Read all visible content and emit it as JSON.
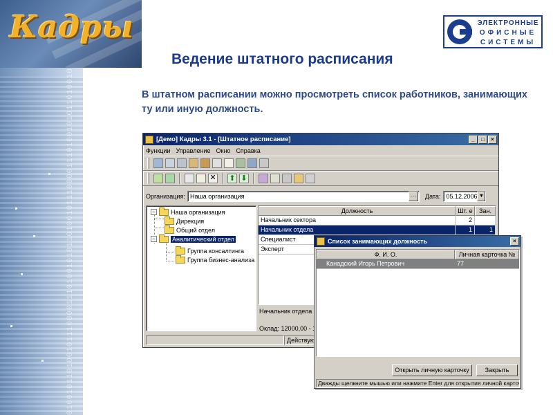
{
  "brand": {
    "name": "Кадры"
  },
  "company_logo": {
    "lines": [
      "ЭЛЕКТРОННЫЕ",
      "ОФИСНЫЕ",
      "СИСТЕМЫ"
    ]
  },
  "slide": {
    "title": "Ведение штатного расписания",
    "subtitle": "В штатном расписании можно просмотреть список работников, занимающих ту или иную должность."
  },
  "app": {
    "window_title": "[Демо] Кадры 3.1 - [Штатное расписание]",
    "menu": [
      "Функции",
      "Управление",
      "Окно",
      "Справка"
    ],
    "org_label": "Организация:",
    "org_value": "Наша организация",
    "date_label": "Дата:",
    "date_value": "05.12.2006",
    "tree": [
      {
        "label": "Наша организация",
        "level": 0
      },
      {
        "label": "Дирекция",
        "level": 1
      },
      {
        "label": "Общий отдел",
        "level": 1
      },
      {
        "label": "Аналитический отдел",
        "level": 1
      },
      {
        "label": "Группа консалтинга",
        "level": 2
      },
      {
        "label": "Группа бизнес-анализа",
        "level": 2
      }
    ],
    "grid": {
      "headers": [
        "Должность",
        "Шт. е",
        "Зан."
      ],
      "rows": [
        [
          "Начальник сектора",
          "2",
          ""
        ],
        [
          "Начальник отдела",
          "1",
          "1"
        ],
        [
          "Специалист",
          "",
          ""
        ],
        [
          "Эксперт",
          "",
          ""
        ]
      ]
    },
    "detail_position": "Начальник отдела",
    "salary_text": "Оклад: 12000,00 - 1",
    "status_action": "Действую"
  },
  "dialog": {
    "title": "Список занимающих должность",
    "headers": [
      "Ф. И. О.",
      "Личная карточка №"
    ],
    "rows": [
      [
        "Канадский Игорь Петрович",
        "77"
      ]
    ],
    "open_card_label": "Открыть личную карточку",
    "close_label": "Закрыть",
    "hint": "Дважды щелкните мышью или нажмите Enter для открытия личной карточки"
  }
}
